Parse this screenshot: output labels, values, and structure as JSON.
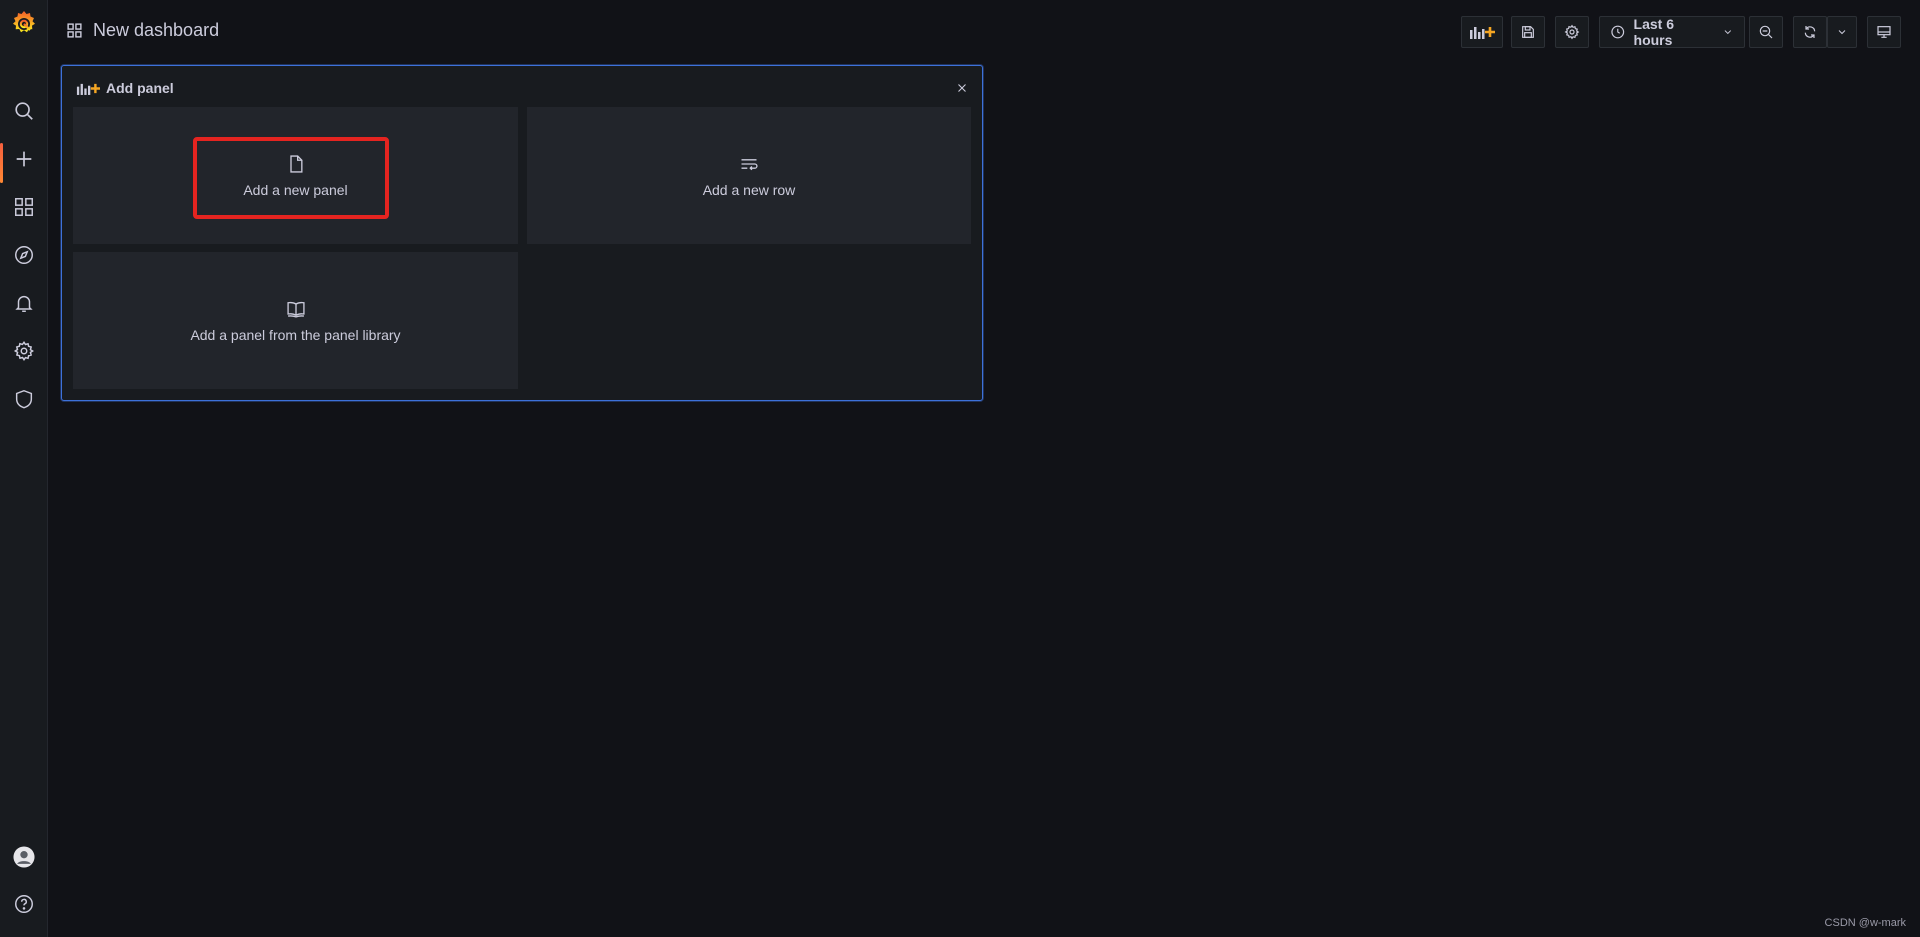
{
  "app": {
    "title": "New dashboard",
    "brand_color": "#f46800",
    "accent_color": "#3d71d9"
  },
  "sidebar": {
    "items": [
      {
        "name": "search",
        "icon": "search-icon"
      },
      {
        "name": "create",
        "icon": "plus-icon",
        "active": true
      },
      {
        "name": "dashboards",
        "icon": "apps-icon"
      },
      {
        "name": "explore",
        "icon": "compass-icon"
      },
      {
        "name": "alerting",
        "icon": "bell-icon"
      },
      {
        "name": "configuration",
        "icon": "gear-icon"
      },
      {
        "name": "server-admin",
        "icon": "shield-icon"
      }
    ],
    "bottom": [
      {
        "name": "profile",
        "icon": "avatar"
      },
      {
        "name": "help",
        "icon": "question-icon"
      }
    ]
  },
  "toolbar": {
    "time_range": "Last 6 hours"
  },
  "add_panel": {
    "title": "Add panel",
    "options": {
      "new_panel": "Add a new panel",
      "new_row": "Add a new row",
      "library": "Add a panel from the panel library"
    }
  },
  "watermark": "CSDN @w-mark"
}
